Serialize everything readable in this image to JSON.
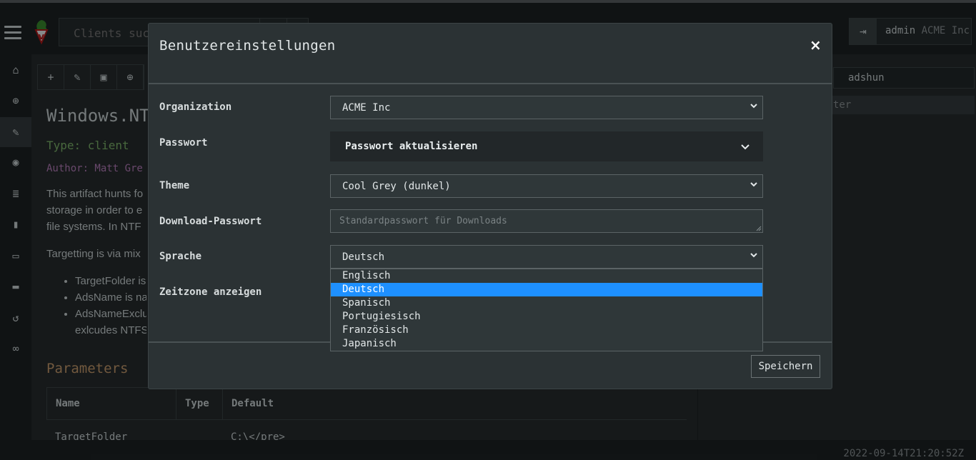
{
  "app": {
    "search_placeholder": "Clients suchen",
    "user": "admin",
    "org": "ACME Inc",
    "timestamp": "2022-09-14T21:20:52Z"
  },
  "sidebar": {
    "items": [
      "home-icon",
      "crosshair-icon",
      "wrench-icon",
      "eye-icon",
      "server-icon",
      "book-icon",
      "laptop-icon",
      "folder-icon",
      "history-icon",
      "binoculars-icon"
    ]
  },
  "artifact": {
    "title": "Windows.NT",
    "type": "Type: client",
    "author": "Author: Matt Gre",
    "desc_lines": [
      "This artifact hunts fo",
      "storage in order to e",
      "file systems. In NTF"
    ],
    "desc_targeting": "Targetting is via mix",
    "bullets": [
      "TargetFolder is",
      "AdsName is na",
      "AdsNameExclu"
    ],
    "bullet_cont": "exlcudes NTFS",
    "params_title": "Parameters",
    "table_headers": [
      "Name",
      "Type",
      "Default"
    ],
    "table_row": [
      "TargetFolder",
      "",
      "C:\\</pre>"
    ]
  },
  "right_panel": {
    "search_value": "adshun",
    "filter_text": "ter"
  },
  "modal": {
    "title": "Benutzereinstellungen",
    "close": "×",
    "fields": {
      "organization_label": "Organization",
      "organization_value": "ACME Inc",
      "password_label": "Passwort",
      "password_toggle": "Passwort aktualisieren",
      "theme_label": "Theme",
      "theme_value": "Cool Grey (dunkel)",
      "download_pw_label": "Download-Passwort",
      "download_pw_placeholder": "Standardpasswort für Downloads",
      "language_label": "Sprache",
      "language_value": "Deutsch",
      "timezone_label": "Zeitzone anzeigen"
    },
    "language_options": [
      "Englisch",
      "Deutsch",
      "Spanisch",
      "Portugiesisch",
      "Französisch",
      "Japanisch"
    ],
    "language_selected": "Deutsch",
    "save_label": "Speichern"
  },
  "colors": {
    "background": "#2a3032",
    "accent_selected": "#1e90ff",
    "type_green": "#7db36a",
    "author_purple": "#b67dba",
    "params_orange": "#c49a6c"
  }
}
